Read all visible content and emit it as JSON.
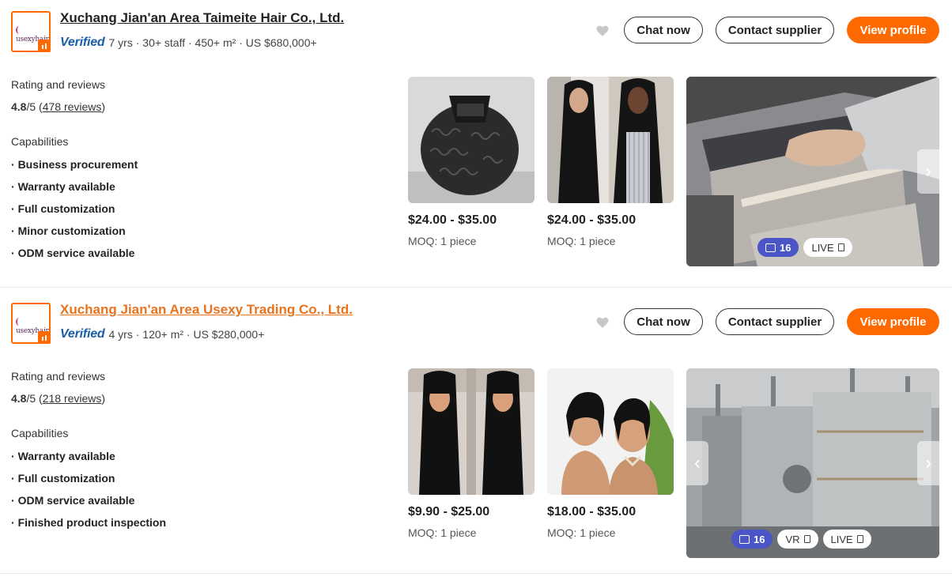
{
  "suppliers": [
    {
      "company": "Xuchang Jian'an Area Taimeite Hair Co., Ltd.",
      "logo_text": "usexyhair",
      "verified": "Verified",
      "meta": "7 yrs · 30+ staff · 450+ m² · US $680,000+",
      "buttons": {
        "chat": "Chat now",
        "contact": "Contact supplier",
        "view": "View profile"
      },
      "rating_title": "Rating and reviews",
      "rating_score": "4.8",
      "rating_scale": "/5 (",
      "reviews": "478 reviews",
      "rating_close": ")",
      "capabilities_title": "Capabilities",
      "capabilities": [
        "Business procurement",
        "Warranty available",
        "Full customization",
        "Minor customization",
        "ODM service available"
      ],
      "products": [
        {
          "price": "$24.00 - $35.00",
          "moq": "MOQ: 1 piece"
        },
        {
          "price": "$24.00 - $35.00",
          "moq": "MOQ: 1 piece"
        }
      ],
      "photos_count": "16",
      "badges": [
        "LIVE"
      ]
    },
    {
      "company": "Xuchang Jian'an Area Usexy Trading Co., Ltd.",
      "logo_text": "usexyhair",
      "verified": "Verified",
      "meta": "4 yrs · 120+ m² · US $280,000+",
      "buttons": {
        "chat": "Chat now",
        "contact": "Contact supplier",
        "view": "View profile"
      },
      "rating_title": "Rating and reviews",
      "rating_score": "4.8",
      "rating_scale": "/5 (",
      "reviews": "218 reviews",
      "rating_close": ")",
      "capabilities_title": "Capabilities",
      "capabilities": [
        "Warranty available",
        "Full customization",
        "ODM service available",
        "Finished product inspection"
      ],
      "products": [
        {
          "price": "$9.90 - $25.00",
          "moq": "MOQ: 1 piece"
        },
        {
          "price": "$18.00 - $35.00",
          "moq": "MOQ: 1 piece"
        }
      ],
      "photos_count": "16",
      "badges": [
        "VR",
        "LIVE"
      ]
    }
  ],
  "colors": {
    "accent": "#ff6a00",
    "verified": "#1a5ea8",
    "photo_badge": "#4a55c8",
    "link_orange": "#e8731f"
  }
}
